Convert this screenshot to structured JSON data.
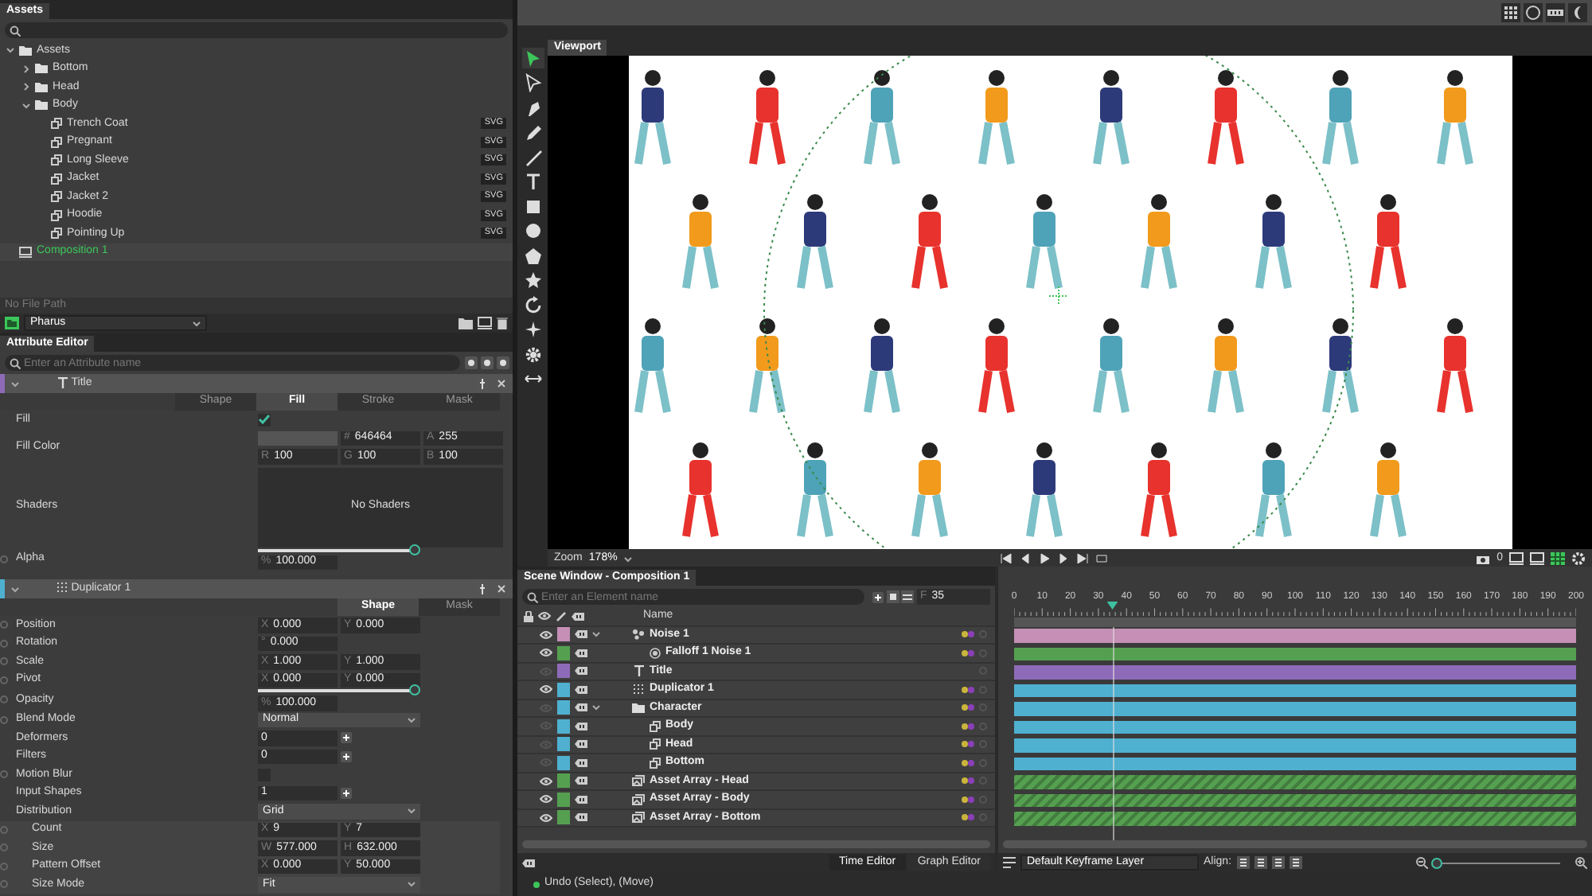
{
  "assets": {
    "tab": "Assets",
    "tree": [
      {
        "label": "Assets",
        "kind": "folder",
        "expanded": true,
        "selected": false,
        "children": [
          {
            "label": "Bottom",
            "kind": "folder",
            "expanded": false,
            "selected": false
          },
          {
            "label": "Head",
            "kind": "folder",
            "expanded": false,
            "selected": false
          },
          {
            "label": "Body",
            "kind": "folder",
            "expanded": true,
            "selected": false,
            "children": [
              {
                "label": "Trench Coat",
                "kind": "asset",
                "badge": "SVG",
                "selected": false
              },
              {
                "label": "Pregnant",
                "kind": "asset",
                "badge": "SVG",
                "selected": false
              },
              {
                "label": "Long Sleeve",
                "kind": "asset",
                "badge": "SVG",
                "selected": false
              },
              {
                "label": "Jacket",
                "kind": "asset",
                "badge": "SVG",
                "selected": false
              },
              {
                "label": "Jacket 2",
                "kind": "asset",
                "badge": "SVG",
                "selected": false
              },
              {
                "label": "Hoodie",
                "kind": "asset",
                "badge": "SVG",
                "selected": false
              },
              {
                "label": "Pointing Up",
                "kind": "asset",
                "badge": "SVG",
                "selected": false
              }
            ]
          }
        ]
      },
      {
        "label": "Composition 1",
        "kind": "composition",
        "selected": true
      }
    ],
    "file_path": "No File Path",
    "project": "Pharus"
  },
  "attribute_editor": {
    "tab": "Attribute Editor",
    "search": {
      "placeholder": "Enter an Attribute name"
    },
    "sections": [
      {
        "name": "Title",
        "kind": "text",
        "color": "#8e6bb8",
        "tabs": [
          {
            "label": "Shape",
            "selected": false
          },
          {
            "label": "Fill",
            "selected": true
          },
          {
            "label": "Stroke",
            "selected": false
          },
          {
            "label": "Mask",
            "selected": false
          }
        ],
        "rows": [
          {
            "kind": "checkbox",
            "label": "Fill",
            "checked": true,
            "animatable": false
          },
          {
            "kind": "color",
            "label": "Fill Color",
            "animatable": false,
            "lines": [
              [
                {
                  "prefix": "#",
                  "value": "646464"
                },
                {
                  "prefix": "A",
                  "value": "255"
                }
              ],
              [
                {
                  "prefix": "R",
                  "value": "100"
                },
                {
                  "prefix": "G",
                  "value": "100"
                },
                {
                  "prefix": "B",
                  "value": "100"
                }
              ]
            ]
          },
          {
            "kind": "panel",
            "label": "Shaders",
            "animatable": false,
            "text": "No Shaders"
          },
          {
            "kind": "slider",
            "label": "Alpha",
            "animatable": true,
            "level": 1,
            "prefix": "%",
            "value": "100.000"
          }
        ]
      },
      {
        "name": "Duplicator 1",
        "kind": "grid",
        "color": "#4fb0d0",
        "tabs": [
          {
            "label": "Shape",
            "selected": true
          },
          {
            "label": "Mask",
            "selected": false
          }
        ],
        "rows": [
          {
            "kind": "fields",
            "label": "Position",
            "animatable": true,
            "fields": [
              {
                "prefix": "X",
                "value": "0.000"
              },
              {
                "prefix": "Y",
                "value": "0.000"
              }
            ]
          },
          {
            "kind": "fields",
            "label": "Rotation",
            "animatable": true,
            "fields": [
              {
                "prefix": "°",
                "value": "0.000"
              }
            ]
          },
          {
            "kind": "fields",
            "label": "Scale",
            "animatable": true,
            "fields": [
              {
                "prefix": "X",
                "value": "1.000"
              },
              {
                "prefix": "Y",
                "value": "1.000"
              }
            ]
          },
          {
            "kind": "fields",
            "label": "Pivot",
            "animatable": true,
            "fields": [
              {
                "prefix": "X",
                "value": "0.000"
              },
              {
                "prefix": "Y",
                "value": "0.000"
              }
            ]
          },
          {
            "kind": "slider",
            "label": "Opacity",
            "animatable": true,
            "level": 1,
            "prefix": "%",
            "value": "100.000"
          },
          {
            "kind": "dropdown",
            "label": "Blend Mode",
            "animatable": true,
            "value": "Normal"
          },
          {
            "kind": "count",
            "label": "Deformers",
            "animatable": false,
            "value": "0"
          },
          {
            "kind": "count",
            "label": "Filters",
            "animatable": false,
            "value": "0"
          },
          {
            "kind": "checkbox",
            "label": "Motion Blur",
            "checked": false,
            "animatable": true
          },
          {
            "kind": "count",
            "label": "Input Shapes",
            "animatable": false,
            "value": "1"
          },
          {
            "kind": "dropdown",
            "label": "Distribution",
            "animatable": false,
            "value": "Grid",
            "children": [
              {
                "kind": "fields",
                "label": "Count",
                "animatable": true,
                "fields": [
                  {
                    "prefix": "X",
                    "value": "9"
                  },
                  {
                    "prefix": "Y",
                    "value": "7"
                  }
                ]
              },
              {
                "kind": "fields",
                "label": "Size",
                "animatable": true,
                "fields": [
                  {
                    "prefix": "W",
                    "value": "577.000"
                  },
                  {
                    "prefix": "H",
                    "value": "632.000"
                  }
                ]
              },
              {
                "kind": "fields",
                "label": "Pattern Offset",
                "animatable": true,
                "fields": [
                  {
                    "prefix": "X",
                    "value": "0.000"
                  },
                  {
                    "prefix": "Y",
                    "value": "50.000"
                  }
                ]
              },
              {
                "kind": "dropdown",
                "label": "Size Mode",
                "animatable": true,
                "value": "Fit"
              }
            ]
          }
        ]
      }
    ]
  },
  "viewport": {
    "tab": "Viewport",
    "tools": [
      {
        "kind": "select",
        "selected": true
      },
      {
        "kind": "direct",
        "selected": false
      },
      {
        "kind": "pen",
        "selected": false
      },
      {
        "kind": "pencil",
        "selected": false
      },
      {
        "kind": "line",
        "selected": false
      },
      {
        "kind": "text",
        "selected": false
      },
      {
        "kind": "rect",
        "selected": false
      },
      {
        "kind": "ellipse",
        "selected": false
      },
      {
        "kind": "polygon",
        "selected": false
      },
      {
        "kind": "star",
        "selected": false
      },
      {
        "kind": "rotate",
        "selected": false
      },
      {
        "kind": "sparkle",
        "selected": false
      },
      {
        "kind": "gear",
        "selected": false
      },
      {
        "kind": "arrows",
        "selected": false
      }
    ],
    "zoom_label": "Zoom",
    "zoom": "178%",
    "frame": "0"
  },
  "scene_window": {
    "tab": "Scene Window - Composition 1",
    "search": {
      "placeholder": "Enter an Element name"
    },
    "frame_prefix": "F",
    "frame": "35",
    "name_column": "Name",
    "elements": [
      {
        "name": "Noise 1",
        "kind": "noise",
        "color": "#c58fb6",
        "visible": true,
        "expanded": true,
        "hatched": false,
        "children": [
          {
            "name": "Falloff 1 Noise 1",
            "kind": "falloff",
            "color": "#55a050",
            "visible": true,
            "hatched": false
          }
        ]
      },
      {
        "name": "Title",
        "kind": "text",
        "color": "#8e6bb8",
        "visible": false,
        "hatched": false
      },
      {
        "name": "Duplicator 1",
        "kind": "grid",
        "color": "#4fb0d0",
        "visible": true,
        "hatched": false
      },
      {
        "name": "Character",
        "kind": "folder",
        "color": "#4fb0d0",
        "visible": false,
        "expanded": true,
        "hatched": false,
        "children": [
          {
            "name": "Body",
            "kind": "asset",
            "color": "#4fb0d0",
            "visible": false,
            "hatched": false
          },
          {
            "name": "Head",
            "kind": "asset",
            "color": "#4fb0d0",
            "visible": false,
            "hatched": false
          },
          {
            "name": "Bottom",
            "kind": "asset",
            "color": "#4fb0d0",
            "visible": false,
            "hatched": false
          }
        ]
      },
      {
        "name": "Asset Array - Head",
        "kind": "array",
        "color": "#55a050",
        "visible": true,
        "hatched": true
      },
      {
        "name": "Asset Array - Body",
        "kind": "array",
        "color": "#55a050",
        "visible": true,
        "hatched": true
      },
      {
        "name": "Asset Array - Bottom",
        "kind": "array",
        "color": "#55a050",
        "visible": true,
        "hatched": true
      }
    ],
    "editors": [
      {
        "label": "Time Editor",
        "selected": true
      },
      {
        "label": "Graph Editor",
        "selected": false
      }
    ]
  },
  "timeline": {
    "ruler": [
      "0",
      "10",
      "20",
      "30",
      "40",
      "50",
      "60",
      "70",
      "80",
      "90",
      "100",
      "110",
      "120",
      "130",
      "140",
      "150",
      "160",
      "170",
      "180",
      "190",
      "200"
    ],
    "playhead": {
      "level": 0.175
    },
    "keyframe_layer": "Default Keyframe Layer",
    "align_label": "Align:",
    "zoom": {
      "level": 0.03
    }
  },
  "status_bar": {
    "message": "Undo (Select), (Move)"
  }
}
